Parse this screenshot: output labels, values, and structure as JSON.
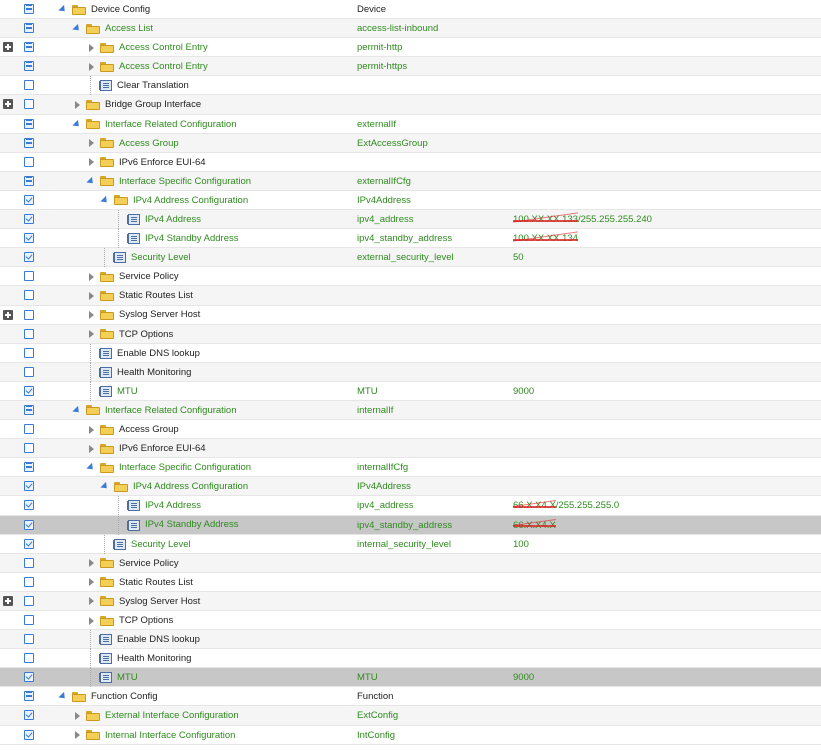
{
  "rows": [
    {
      "expander": false,
      "cb": "partial",
      "indent": 0,
      "tw": "open",
      "icon": "folder",
      "label": "Device Config",
      "labelColor": "dark",
      "c2": "Device",
      "c2Color": "dark",
      "c3": "",
      "c3Color": "green",
      "alt": false,
      "sel": false
    },
    {
      "expander": false,
      "cb": "partial",
      "indent": 1,
      "tw": "open",
      "icon": "folder",
      "label": "Access List",
      "labelColor": "green",
      "c2": "access-list-inbound",
      "c2Color": "green",
      "c3": "",
      "alt": true,
      "sel": false
    },
    {
      "expander": true,
      "cb": "partial",
      "indent": 2,
      "tw": "closed",
      "icon": "folder",
      "label": "Access Control Entry",
      "labelColor": "green",
      "c2": "permit-http",
      "c2Color": "green",
      "c3": "",
      "alt": false,
      "sel": false
    },
    {
      "expander": false,
      "cb": "partial",
      "indent": 2,
      "tw": "closed",
      "icon": "folder",
      "label": "Access Control Entry",
      "labelColor": "green",
      "c2": "permit-https",
      "c2Color": "green",
      "c3": "",
      "alt": true,
      "sel": false
    },
    {
      "expander": false,
      "cb": "empty",
      "indent": 2,
      "tw": "none",
      "icon": "leaf",
      "label": "Clear Translation",
      "labelColor": "dark",
      "c2": "",
      "c3": "",
      "alt": false,
      "sel": false
    },
    {
      "expander": true,
      "cb": "empty",
      "indent": 1,
      "tw": "closed",
      "icon": "folder",
      "label": "Bridge Group Interface",
      "labelColor": "dark",
      "c2": "",
      "c3": "",
      "alt": true,
      "sel": false
    },
    {
      "expander": false,
      "cb": "partial",
      "indent": 1,
      "tw": "open",
      "icon": "folder",
      "label": "Interface Related Configuration",
      "labelColor": "green",
      "c2": "externalIf",
      "c2Color": "green",
      "c3": "",
      "alt": false,
      "sel": false
    },
    {
      "expander": false,
      "cb": "partial",
      "indent": 2,
      "tw": "closed",
      "icon": "folder",
      "label": "Access Group",
      "labelColor": "green",
      "c2": "ExtAccessGroup",
      "c2Color": "green",
      "c3": "",
      "alt": true,
      "sel": false
    },
    {
      "expander": false,
      "cb": "empty",
      "indent": 2,
      "tw": "closed",
      "icon": "folder",
      "label": "IPv6 Enforce EUI-64",
      "labelColor": "dark",
      "c2": "",
      "c3": "",
      "alt": false,
      "sel": false
    },
    {
      "expander": false,
      "cb": "partial",
      "indent": 2,
      "tw": "open",
      "icon": "folder",
      "label": "Interface Specific Configuration",
      "labelColor": "green",
      "c2": "externalIfCfg",
      "c2Color": "green",
      "c3": "",
      "alt": true,
      "sel": false
    },
    {
      "expander": false,
      "cb": "checked",
      "indent": 3,
      "tw": "open",
      "icon": "folder",
      "label": "IPv4 Address Configuration",
      "labelColor": "green",
      "c2": "IPv4Address",
      "c2Color": "green",
      "c3": "",
      "alt": false,
      "sel": false
    },
    {
      "expander": false,
      "cb": "checked",
      "indent": 4,
      "tw": "none",
      "icon": "leaf",
      "label": "IPv4 Address",
      "labelColor": "green",
      "c2": "ipv4_address",
      "c2Color": "green",
      "c3red": "100.XX.XX.133",
      "c3": "/255.255.255.240",
      "alt": true,
      "sel": false
    },
    {
      "expander": false,
      "cb": "checked",
      "indent": 4,
      "tw": "none",
      "icon": "leaf",
      "label": "IPv4 Standby Address",
      "labelColor": "green",
      "c2": "ipv4_standby_address",
      "c2Color": "green",
      "c3red": "100.XX.XX.134",
      "c3": "",
      "alt": false,
      "sel": false
    },
    {
      "expander": false,
      "cb": "checked",
      "indent": 3,
      "tw": "none",
      "icon": "leaf",
      "label": "Security Level",
      "labelColor": "green",
      "c2": "external_security_level",
      "c2Color": "green",
      "c3": "50",
      "alt": true,
      "sel": false
    },
    {
      "expander": false,
      "cb": "empty",
      "indent": 2,
      "tw": "closed",
      "icon": "folder",
      "label": "Service Policy",
      "labelColor": "dark",
      "c2": "",
      "c3": "",
      "alt": false,
      "sel": false
    },
    {
      "expander": false,
      "cb": "empty",
      "indent": 2,
      "tw": "closed",
      "icon": "folder",
      "label": "Static Routes List",
      "labelColor": "dark",
      "c2": "",
      "c3": "",
      "alt": true,
      "sel": false
    },
    {
      "expander": true,
      "cb": "empty",
      "indent": 2,
      "tw": "closed",
      "icon": "folder",
      "label": "Syslog Server Host",
      "labelColor": "dark",
      "c2": "",
      "c3": "",
      "alt": false,
      "sel": false
    },
    {
      "expander": false,
      "cb": "empty",
      "indent": 2,
      "tw": "closed",
      "icon": "folder",
      "label": "TCP Options",
      "labelColor": "dark",
      "c2": "",
      "c3": "",
      "alt": true,
      "sel": false
    },
    {
      "expander": false,
      "cb": "empty",
      "indent": 2,
      "tw": "none",
      "icon": "leaf",
      "label": "Enable DNS lookup",
      "labelColor": "dark",
      "c2": "",
      "c3": "",
      "alt": false,
      "sel": false
    },
    {
      "expander": false,
      "cb": "empty",
      "indent": 2,
      "tw": "none",
      "icon": "leaf",
      "label": "Health Monitoring",
      "labelColor": "dark",
      "c2": "",
      "c3": "",
      "alt": true,
      "sel": false
    },
    {
      "expander": false,
      "cb": "checked",
      "indent": 2,
      "tw": "none",
      "icon": "leaf",
      "label": "MTU",
      "labelColor": "green",
      "c2": "MTU",
      "c2Color": "green",
      "c3": "9000",
      "alt": false,
      "sel": false
    },
    {
      "expander": false,
      "cb": "partial",
      "indent": 1,
      "tw": "open",
      "icon": "folder",
      "label": "Interface Related Configuration",
      "labelColor": "green",
      "c2": "internalIf",
      "c2Color": "green",
      "c3": "",
      "alt": true,
      "sel": false
    },
    {
      "expander": false,
      "cb": "empty",
      "indent": 2,
      "tw": "closed",
      "icon": "folder",
      "label": "Access Group",
      "labelColor": "dark",
      "c2": "",
      "c3": "",
      "alt": false,
      "sel": false
    },
    {
      "expander": false,
      "cb": "empty",
      "indent": 2,
      "tw": "closed",
      "icon": "folder",
      "label": "IPv6 Enforce EUI-64",
      "labelColor": "dark",
      "c2": "",
      "c3": "",
      "alt": true,
      "sel": false
    },
    {
      "expander": false,
      "cb": "partial",
      "indent": 2,
      "tw": "open",
      "icon": "folder",
      "label": "Interface Specific Configuration",
      "labelColor": "green",
      "c2": "internalIfCfg",
      "c2Color": "green",
      "c3": "",
      "alt": false,
      "sel": false
    },
    {
      "expander": false,
      "cb": "checked",
      "indent": 3,
      "tw": "open",
      "icon": "folder",
      "label": "IPv4 Address Configuration",
      "labelColor": "green",
      "c2": "IPv4Address",
      "c2Color": "green",
      "c3": "",
      "alt": true,
      "sel": false
    },
    {
      "expander": false,
      "cb": "checked",
      "indent": 4,
      "tw": "none",
      "icon": "leaf",
      "label": "IPv4 Address",
      "labelColor": "green",
      "c2": "ipv4_address",
      "c2Color": "green",
      "c3red": "66.X.X4.X",
      "c3": "/255.255.255.0",
      "alt": false,
      "sel": false
    },
    {
      "expander": false,
      "cb": "checked",
      "indent": 4,
      "tw": "none",
      "icon": "leaf",
      "label": "IPv4 Standby Address",
      "labelColor": "green",
      "c2": "ipv4_standby_address",
      "c2Color": "green",
      "c3red": "66.X.X4.X",
      "c3": "",
      "alt": false,
      "sel": true
    },
    {
      "expander": false,
      "cb": "checked",
      "indent": 3,
      "tw": "none",
      "icon": "leaf",
      "label": "Security Level",
      "labelColor": "green",
      "c2": "internal_security_level",
      "c2Color": "green",
      "c3": "100",
      "alt": false,
      "sel": false
    },
    {
      "expander": false,
      "cb": "empty",
      "indent": 2,
      "tw": "closed",
      "icon": "folder",
      "label": "Service Policy",
      "labelColor": "dark",
      "c2": "",
      "c3": "",
      "alt": true,
      "sel": false
    },
    {
      "expander": false,
      "cb": "empty",
      "indent": 2,
      "tw": "closed",
      "icon": "folder",
      "label": "Static Routes List",
      "labelColor": "dark",
      "c2": "",
      "c3": "",
      "alt": false,
      "sel": false
    },
    {
      "expander": true,
      "cb": "empty",
      "indent": 2,
      "tw": "closed",
      "icon": "folder",
      "label": "Syslog Server Host",
      "labelColor": "dark",
      "c2": "",
      "c3": "",
      "alt": true,
      "sel": false
    },
    {
      "expander": false,
      "cb": "empty",
      "indent": 2,
      "tw": "closed",
      "icon": "folder",
      "label": "TCP Options",
      "labelColor": "dark",
      "c2": "",
      "c3": "",
      "alt": false,
      "sel": false
    },
    {
      "expander": false,
      "cb": "empty",
      "indent": 2,
      "tw": "none",
      "icon": "leaf",
      "label": "Enable DNS lookup",
      "labelColor": "dark",
      "c2": "",
      "c3": "",
      "alt": true,
      "sel": false
    },
    {
      "expander": false,
      "cb": "empty",
      "indent": 2,
      "tw": "none",
      "icon": "leaf",
      "label": "Health Monitoring",
      "labelColor": "dark",
      "c2": "",
      "c3": "",
      "alt": false,
      "sel": false
    },
    {
      "expander": false,
      "cb": "checked",
      "indent": 2,
      "tw": "none",
      "icon": "leaf",
      "label": "MTU",
      "labelColor": "green",
      "c2": "MTU",
      "c2Color": "green",
      "c3": "9000",
      "alt": false,
      "sel": true
    },
    {
      "expander": false,
      "cb": "partial",
      "indent": 0,
      "tw": "open",
      "icon": "folder",
      "label": "Function Config",
      "labelColor": "dark",
      "c2": "Function",
      "c2Color": "dark",
      "c3": "",
      "alt": false,
      "sel": false
    },
    {
      "expander": false,
      "cb": "checked",
      "indent": 1,
      "tw": "closed",
      "icon": "folder",
      "label": "External Interface Configuration",
      "labelColor": "green",
      "c2": "ExtConfig",
      "c2Color": "green",
      "c3": "",
      "alt": true,
      "sel": false
    },
    {
      "expander": false,
      "cb": "checked",
      "indent": 1,
      "tw": "closed",
      "icon": "folder",
      "label": "Internal Interface Configuration",
      "labelColor": "green",
      "c2": "IntConfig",
      "c2Color": "green",
      "c3": "",
      "alt": false,
      "sel": false
    }
  ]
}
